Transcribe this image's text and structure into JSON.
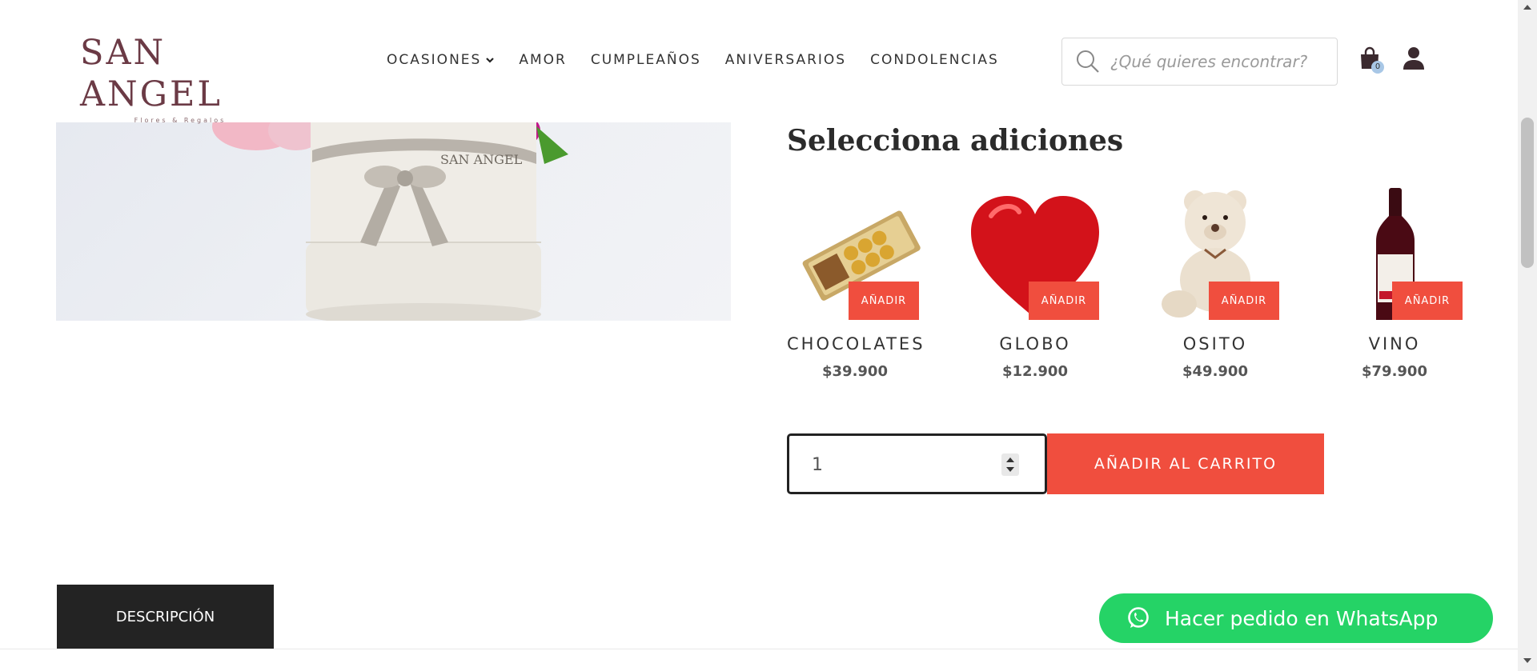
{
  "brand": {
    "name": "SAN ANGEL",
    "tagline": "Flores & Regalos"
  },
  "nav": {
    "items": [
      {
        "label": "OCASIONES",
        "has_dropdown": true
      },
      {
        "label": "AMOR"
      },
      {
        "label": "CUMPLEAÑOS"
      },
      {
        "label": "ANIVERSARIOS"
      },
      {
        "label": "CONDOLENCIAS"
      }
    ]
  },
  "search": {
    "placeholder": "¿Qué quieres encontrar?",
    "icon": "search-icon"
  },
  "cart": {
    "count": "0",
    "icon": "shopping-bag-icon"
  },
  "account": {
    "icon": "user-icon"
  },
  "additions": {
    "title": "Selecciona adiciones",
    "add_label": "AÑADIR",
    "items": [
      {
        "name": "CHOCOLATES",
        "price": "$39.900"
      },
      {
        "name": "GLOBO",
        "price": "$12.900"
      },
      {
        "name": "OSITO",
        "price": "$49.900"
      },
      {
        "name": "VINO",
        "price": "$79.900"
      }
    ]
  },
  "purchase": {
    "quantity": "1",
    "add_to_cart_label": "AÑADIR AL CARRITO"
  },
  "tabs": {
    "description_label": "DESCRIPCIÓN"
  },
  "whatsapp": {
    "label": "Hacer pedido en WhatsApp"
  },
  "product_image_text": {
    "ribbon": "SAN ANGEL"
  },
  "colors": {
    "accent": "#f04e3e",
    "brand": "#6b3a45",
    "whatsapp": "#25d366",
    "dark": "#232323"
  }
}
